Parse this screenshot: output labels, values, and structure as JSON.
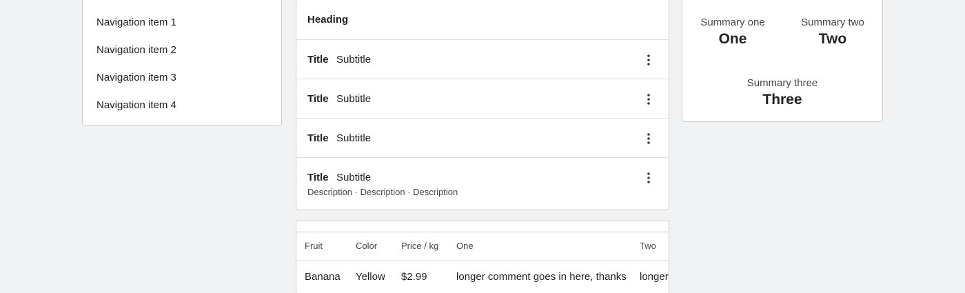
{
  "navigation": {
    "items": [
      {
        "label": "Navigation item 1"
      },
      {
        "label": "Navigation item 2"
      },
      {
        "label": "Navigation item 3"
      },
      {
        "label": "Navigation item 4"
      }
    ]
  },
  "list": {
    "heading": "Heading",
    "rows": [
      {
        "title": "Title",
        "subtitle": "Subtitle",
        "description": ""
      },
      {
        "title": "Title",
        "subtitle": "Subtitle",
        "description": ""
      },
      {
        "title": "Title",
        "subtitle": "Subtitle",
        "description": ""
      },
      {
        "title": "Title",
        "subtitle": "Subtitle",
        "description": "Description · Description · Description"
      }
    ],
    "row_action_icon": "more-vertical-icon"
  },
  "table": {
    "columns": [
      "Fruit",
      "Color",
      "Price / kg",
      "One",
      "Two"
    ],
    "rows": [
      [
        "Banana",
        "Yellow",
        "$2.99",
        "longer comment goes in here, thanks",
        "longer"
      ]
    ]
  },
  "summary": {
    "items": [
      {
        "label": "Summary one",
        "value": "One"
      },
      {
        "label": "Summary two",
        "value": "Two"
      },
      {
        "label": "Summary three",
        "value": "Three"
      }
    ]
  }
}
